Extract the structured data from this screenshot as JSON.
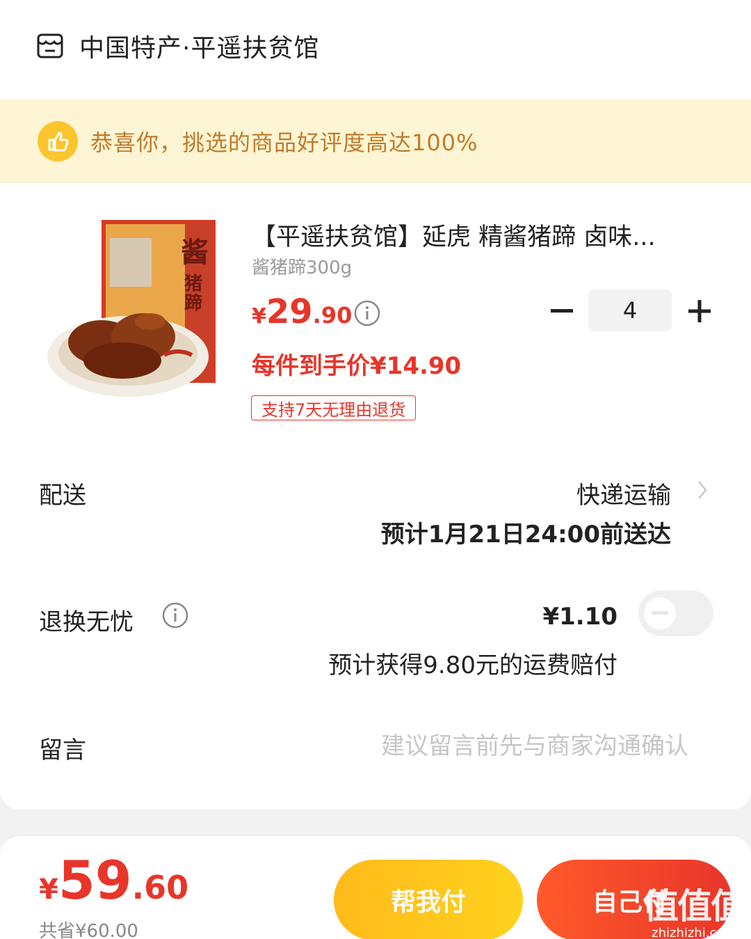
{
  "shop": {
    "name": "中国特产·平遥扶贫馆",
    "icon": "shop-icon"
  },
  "banner": {
    "text": "恭喜你，挑选的商品好评度高达100%",
    "icon": "thumbs-up-icon"
  },
  "product": {
    "title": "【平遥扶贫馆】延虎 精酱猪蹄 卤味...",
    "spec": "酱猪蹄300g",
    "price_symbol": "¥",
    "price_int": "29",
    "price_dec": ".90",
    "quantity": "4",
    "unit_price": "每件到手价¥14.90",
    "return_tag": "支持7天无理由退货",
    "image_text": {
      "big": "酱",
      "small": "猪蹄"
    }
  },
  "delivery": {
    "label": "配送",
    "method": "快递运输",
    "eta": "预计1月21日24:00前送达"
  },
  "return_insurance": {
    "label": "退换无忧",
    "price": "¥1.10",
    "desc": "预计获得9.80元的运费赔付",
    "enabled": false
  },
  "message": {
    "label": "留言",
    "placeholder": "建议留言前先与商家沟通确认",
    "value": ""
  },
  "footer": {
    "price_symbol": "¥",
    "total_int": "59",
    "total_dec": ".60",
    "saved": "共省¥60.00",
    "btn_help": "帮我付",
    "btn_self": "自己付"
  },
  "watermark": {
    "logo": "值值值",
    "url": "zhizhizhi.com"
  },
  "colors": {
    "accent_red": "#e8352a",
    "accent_yellow": "#ffc21c",
    "banner_bg": "#fdf5d3",
    "banner_text": "#c17a2b"
  }
}
